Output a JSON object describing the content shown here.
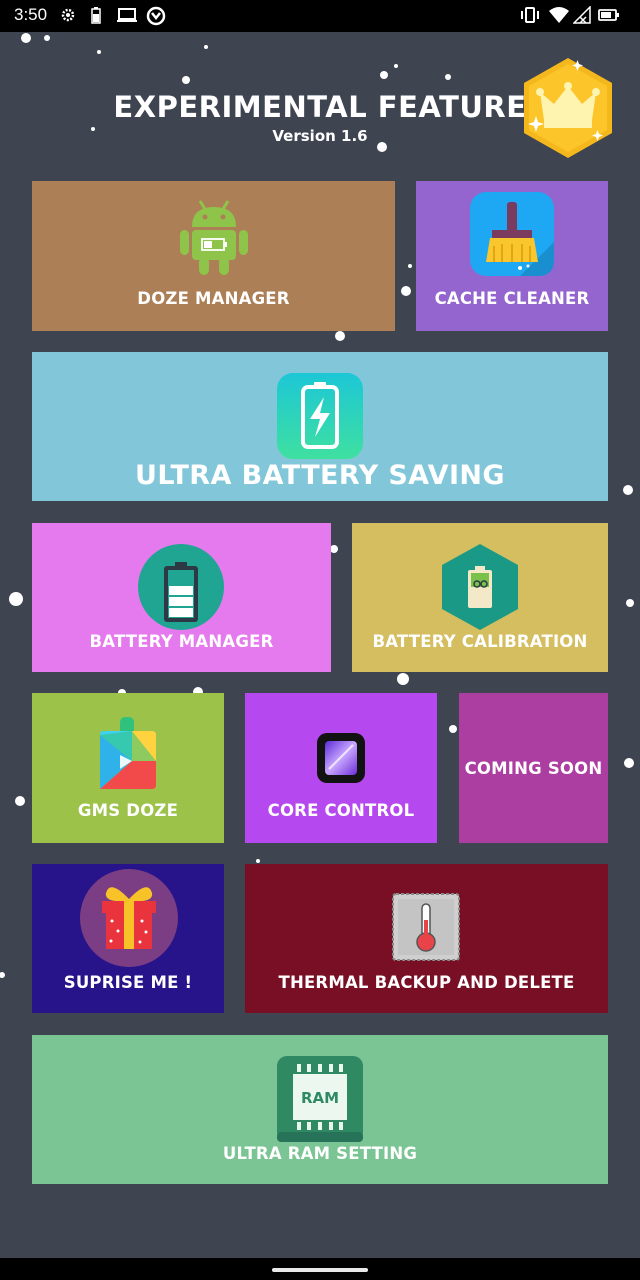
{
  "status_bar": {
    "time": "3:50"
  },
  "header": {
    "title": "EXPERIMENTAL FEATURE",
    "version": "Version 1.6"
  },
  "tiles": {
    "doze_manager": {
      "label": "DOZE MANAGER",
      "color": "#ac7f56"
    },
    "cache_cleaner": {
      "label": "CACHE CLEANER",
      "color": "#9565cf"
    },
    "ultra_battery_saving": {
      "label": "ULTRA BATTERY SAVING",
      "color": "#82c6d9"
    },
    "battery_manager": {
      "label": "BATTERY MANAGER",
      "color": "#e579ee"
    },
    "battery_calibration": {
      "label": "BATTERY CALIBRATION",
      "color": "#d4be60"
    },
    "gms_doze": {
      "label": "GMS DOZE",
      "color": "#9dc24a"
    },
    "core_control": {
      "label": "CORE CONTROL",
      "color": "#b648ef"
    },
    "coming_soon": {
      "label": "COMING SOON",
      "color": "#ad3ea1"
    },
    "suprise_me": {
      "label": "SUPRISE ME !",
      "color": "#28148a"
    },
    "thermal_backup": {
      "label": "THERMAL BACKUP AND DELETE",
      "color": "#790f25"
    },
    "ultra_ram_setting": {
      "label": "ULTRA RAM SETTING",
      "color": "#7bc594",
      "icon_text": "RAM"
    }
  }
}
